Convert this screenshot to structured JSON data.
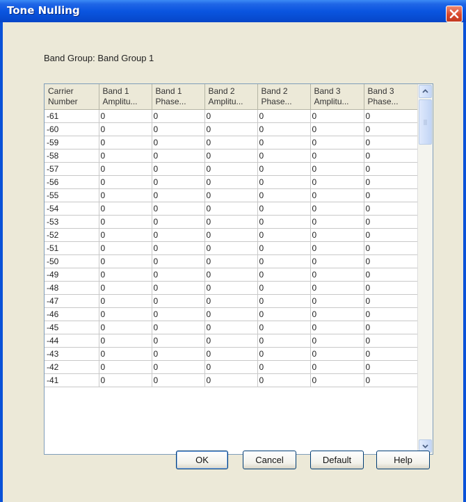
{
  "window": {
    "title": "Tone Nulling"
  },
  "group_label": "Band Group: Band Group 1",
  "table": {
    "columns": [
      [
        "Carrier",
        "Number"
      ],
      [
        "Band 1",
        "Amplitu..."
      ],
      [
        "Band 1",
        "Phase..."
      ],
      [
        "Band 2",
        "Amplitu..."
      ],
      [
        "Band 2",
        "Phase..."
      ],
      [
        "Band 3",
        "Amplitu..."
      ],
      [
        "Band 3",
        "Phase..."
      ]
    ],
    "rows": [
      [
        "-61",
        "0",
        "0",
        "0",
        "0",
        "0",
        "0"
      ],
      [
        "-60",
        "0",
        "0",
        "0",
        "0",
        "0",
        "0"
      ],
      [
        "-59",
        "0",
        "0",
        "0",
        "0",
        "0",
        "0"
      ],
      [
        "-58",
        "0",
        "0",
        "0",
        "0",
        "0",
        "0"
      ],
      [
        "-57",
        "0",
        "0",
        "0",
        "0",
        "0",
        "0"
      ],
      [
        "-56",
        "0",
        "0",
        "0",
        "0",
        "0",
        "0"
      ],
      [
        "-55",
        "0",
        "0",
        "0",
        "0",
        "0",
        "0"
      ],
      [
        "-54",
        "0",
        "0",
        "0",
        "0",
        "0",
        "0"
      ],
      [
        "-53",
        "0",
        "0",
        "0",
        "0",
        "0",
        "0"
      ],
      [
        "-52",
        "0",
        "0",
        "0",
        "0",
        "0",
        "0"
      ],
      [
        "-51",
        "0",
        "0",
        "0",
        "0",
        "0",
        "0"
      ],
      [
        "-50",
        "0",
        "0",
        "0",
        "0",
        "0",
        "0"
      ],
      [
        "-49",
        "0",
        "0",
        "0",
        "0",
        "0",
        "0"
      ],
      [
        "-48",
        "0",
        "0",
        "0",
        "0",
        "0",
        "0"
      ],
      [
        "-47",
        "0",
        "0",
        "0",
        "0",
        "0",
        "0"
      ],
      [
        "-46",
        "0",
        "0",
        "0",
        "0",
        "0",
        "0"
      ],
      [
        "-45",
        "0",
        "0",
        "0",
        "0",
        "0",
        "0"
      ],
      [
        "-44",
        "0",
        "0",
        "0",
        "0",
        "0",
        "0"
      ],
      [
        "-43",
        "0",
        "0",
        "0",
        "0",
        "0",
        "0"
      ],
      [
        "-42",
        "0",
        "0",
        "0",
        "0",
        "0",
        "0"
      ],
      [
        "-41",
        "0",
        "0",
        "0",
        "0",
        "0",
        "0"
      ]
    ]
  },
  "buttons": {
    "ok": "OK",
    "cancel": "Cancel",
    "default": "Default",
    "help": "Help"
  },
  "icons": {
    "close": "close-icon",
    "scroll_up": "chevron-up-icon",
    "scroll_down": "chevron-down-icon"
  },
  "colors": {
    "titlebar": "#0a55e0",
    "close": "#d9482c",
    "dialog_bg": "#ece9d8"
  }
}
